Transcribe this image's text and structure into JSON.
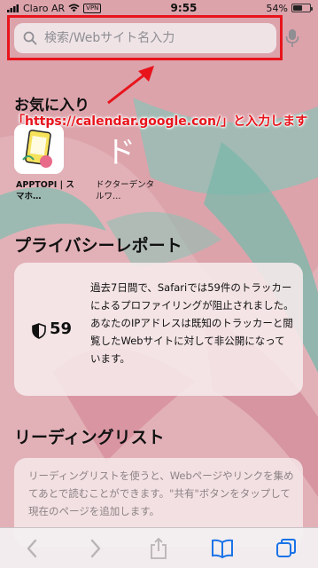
{
  "status_bar": {
    "carrier": "Claro AR",
    "vpn": "VPN",
    "time": "9:55",
    "battery": "54%",
    "battery_level": 0.54
  },
  "search": {
    "placeholder": "検索/Webサイト名入力"
  },
  "annotation": {
    "text": "「https://calendar.google.con/」と入力します",
    "color": "#e8141c"
  },
  "favorites": {
    "title": "お気に入り",
    "items": [
      {
        "label": "APPTOPI | スマホ…",
        "icon": "apptopi-icon"
      },
      {
        "label": "ドクターデンタルワ…",
        "glyph": "ド",
        "icon": "doctor-dental-icon"
      }
    ]
  },
  "privacy": {
    "title": "プライバシーレポート",
    "count": "59",
    "text": "過去7日間で、Safariでは59件のトラッカーによるプロファイリングが阻止されました。あなたのIPアドレスは既知のトラッカーと閲覧したWebサイトに対して非公開になっています。"
  },
  "reading_list": {
    "title": "リーディングリスト",
    "text": "リーディングリストを使うと、Webページやリンクを集めてあとで読むことができます。\"共有\"ボタンをタップして現在のページを追加します。"
  },
  "toolbar": {
    "items": [
      "back-icon",
      "forward-icon",
      "share-icon",
      "bookmarks-icon",
      "tabs-icon"
    ]
  },
  "colors": {
    "accent": "#1a73e8",
    "highlight": "#e8141c",
    "background": "#dca3ab"
  }
}
